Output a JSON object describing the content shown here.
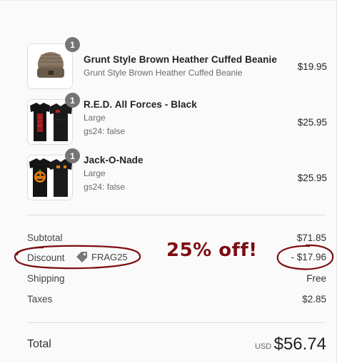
{
  "items": [
    {
      "title": "Grunt Style Brown Heather Cuffed Beanie",
      "subtitle": "Grunt Style Brown Heather Cuffed Beanie",
      "price": "$19.95",
      "quantity": "1",
      "image_icon": "beanie-image"
    },
    {
      "title": "R.E.D. All Forces - Black",
      "variant": "Large",
      "property": "gs24: false",
      "price": "$25.95",
      "quantity": "1",
      "image_icon": "black-tshirt-red-print-image"
    },
    {
      "title": "Jack-O-Nade",
      "variant": "Large",
      "property": "gs24: false",
      "price": "$25.95",
      "quantity": "1",
      "image_icon": "black-tshirt-orange-print-image"
    }
  ],
  "summary": {
    "subtotal_label": "Subtotal",
    "subtotal_value": "$71.85",
    "discount_label": "Discount",
    "discount_code": "FRAG25",
    "discount_value": "- $17.96",
    "shipping_label": "Shipping",
    "shipping_value": "Free",
    "taxes_label": "Taxes",
    "taxes_value": "$2.85"
  },
  "annotation": {
    "text": "25% off!",
    "color": "#7d0d12"
  },
  "total": {
    "label": "Total",
    "currency": "USD",
    "value": "$56.74"
  }
}
